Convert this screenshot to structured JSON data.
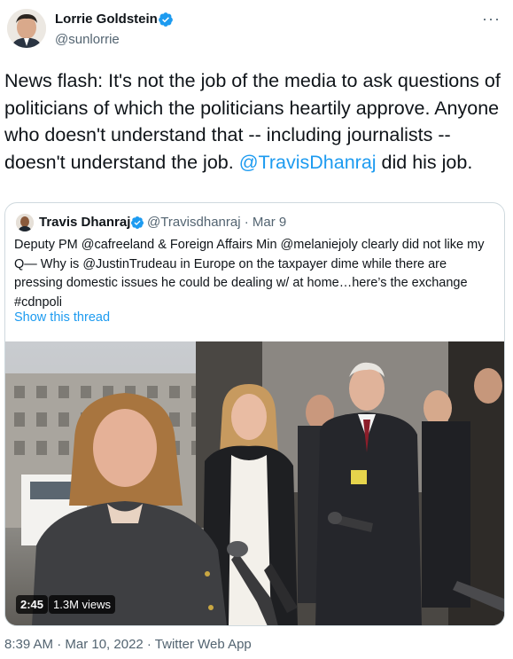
{
  "tweet": {
    "author_name": "Lorrie Goldstein",
    "author_handle": "@sunlorrie",
    "more_icon": "···",
    "text_intro": "News flash: It's not the job of the media to ask questions of politicians of which the politicians heartily approve. Anyone who doesn't understand that -- including journalists -- doesn't understand the job.",
    "mention": "@TravisDhanraj",
    "text_outro": " did his job.",
    "timestamp": "8:39 AM · Mar 10, 2022 · Twitter Web App"
  },
  "quote": {
    "author_name": "Travis Dhanraj",
    "meta": "@Travisdhanraj · Mar 9",
    "text": "Deputy PM @cafreeland & Foreign Affairs Min @melaniejoly clearly did not like my Q— Why is @JustinTrudeau in Europe on the taxpayer dime while there are pressing domestic issues he could be dealing w/ at home…here’s the exchange #cdnpoli",
    "show_thread": "Show this thread",
    "video_duration": "2:45",
    "video_views": "1.3M views"
  },
  "colors": {
    "accent": "#1d9bf0",
    "secondary_text": "#536471",
    "border": "#cfd9de"
  }
}
